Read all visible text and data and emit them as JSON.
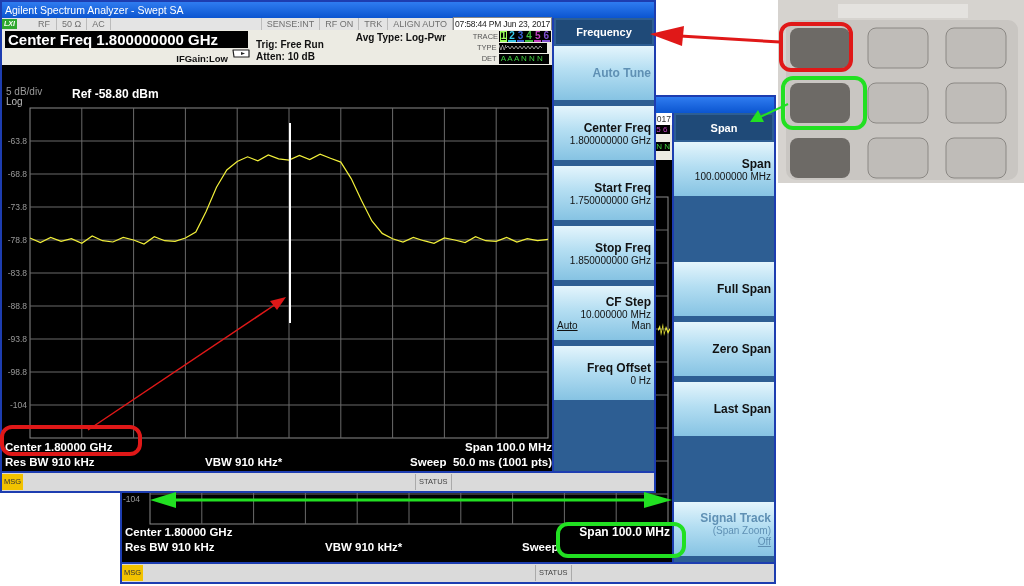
{
  "main_window": {
    "title": "Agilent Spectrum Analyzer - Swept SA",
    "lxi_badge": "LXI",
    "status_cells": [
      "RF",
      "50 Ω",
      "AC",
      "SENSE:INT",
      "RF ON",
      "TRK",
      "ALIGN AUTO"
    ],
    "timestamp": "07:58:44 PM Jun 23, 2017",
    "center_freq_banner": "Center Freq 1.800000000 GHz",
    "if_gain": "IFGain:Low",
    "trigger": "Trig: Free Run",
    "atten": "Atten: 10 dB",
    "avg_type": "Avg Type: Log-Pwr",
    "trace_panel": {
      "trace_label": "TRACE",
      "traces": [
        {
          "label": "1",
          "color": "#9cff5a",
          "selected": true
        },
        {
          "label": "2",
          "color": "#38c8e8",
          "selected": false
        },
        {
          "label": "3",
          "color": "#3a62d8",
          "selected": false
        },
        {
          "label": "4",
          "color": "#40c040",
          "selected": false
        },
        {
          "label": "5",
          "color": "#c040c0",
          "selected": false
        },
        {
          "label": "6",
          "color": "#8050d0",
          "selected": false
        }
      ],
      "type_label": "TYPE",
      "type_value": "W",
      "det_label": "DET",
      "det_value": "A A A N N N"
    },
    "scale": "5 dB/div",
    "ref": "Ref -58.80 dBm",
    "log": "Log",
    "chart_data": {
      "type": "line",
      "grid": true,
      "ylim": [
        -108.8,
        -58.8
      ],
      "yticks": [
        {
          "value": -63.8,
          "label": "-63.8"
        },
        {
          "value": -68.8,
          "label": "-68.8"
        },
        {
          "value": -73.8,
          "label": "-73.8"
        },
        {
          "value": -78.8,
          "label": "-78.8"
        },
        {
          "value": -83.8,
          "label": "-83.8"
        },
        {
          "value": -88.8,
          "label": "-88.8"
        },
        {
          "value": -93.8,
          "label": "-93.8"
        },
        {
          "value": -98.8,
          "label": "-98.8"
        },
        {
          "value": -103.8,
          "label": "-104"
        }
      ],
      "categories": [
        null,
        null,
        null,
        null,
        null,
        null,
        null,
        null,
        null,
        null,
        null,
        null,
        null,
        null,
        null,
        null,
        null,
        null,
        null,
        null,
        null,
        null,
        null,
        null,
        null,
        null,
        null,
        null,
        null,
        null,
        null,
        null,
        null,
        null,
        null,
        null,
        null,
        null,
        null,
        null,
        null,
        null,
        null,
        null,
        null,
        null,
        null,
        null,
        null,
        null,
        null
      ],
      "series": [
        {
          "color": "#f2f03a",
          "values": [
            -78.5,
            -79.2,
            -78.4,
            -79.0,
            -78.6,
            -79.3,
            -78.2,
            -78.9,
            -79.1,
            -78.4,
            -78.8,
            -79.4,
            -78.3,
            -78.9,
            -79.0,
            -78.5,
            -77.6,
            -74.5,
            -70.8,
            -68.2,
            -66.9,
            -66.2,
            -66.8,
            -65.9,
            -66.5,
            -66.7,
            -66.0,
            -66.6,
            -65.8,
            -66.4,
            -67.0,
            -69.5,
            -72.8,
            -75.9,
            -77.8,
            -78.6,
            -79.1,
            -78.4,
            -78.9,
            -79.3,
            -78.5,
            -78.8,
            -79.2,
            -78.3,
            -78.9,
            -79.0,
            -78.4,
            -79.1,
            -78.6,
            -78.9,
            -78.7
          ]
        }
      ]
    },
    "center": "Center 1.80000 GHz",
    "res_bw": "Res BW 910 kHz",
    "vbw": "VBW 910 kHz*",
    "span": "Span 100.0 MHz",
    "sweep": "Sweep  50.0 ms (1001 pts)",
    "msg": "MSG",
    "status": "STATUS",
    "softkey_menu": {
      "title": "Frequency",
      "keys": [
        {
          "kind": "plain",
          "label": "Auto Tune",
          "disabled": true
        },
        {
          "kind": "value",
          "label": "Center Freq",
          "value": "1.800000000 GHz",
          "disabled": false
        },
        {
          "kind": "value",
          "label": "Start Freq",
          "value": "1.750000000 GHz",
          "disabled": false
        },
        {
          "kind": "value",
          "label": "Stop Freq",
          "value": "1.850000000 GHz",
          "disabled": false
        },
        {
          "kind": "toggle",
          "label": "CF Step",
          "value": "10.000000 MHz",
          "disabled": false,
          "options": [
            {
              "label": "Auto",
              "selected": true
            },
            {
              "label": "Man",
              "selected": false
            }
          ]
        },
        {
          "kind": "value",
          "label": "Freq Offset",
          "value": "0 Hz",
          "disabled": false
        }
      ]
    }
  },
  "second_window": {
    "clock_fragment": "017",
    "trace_fragment": "5 6",
    "det_fragment": "N N",
    "y_label": "-104",
    "center": "Center 1.80000 GHz",
    "res_bw": "Res BW 910 kHz",
    "vbw": "VBW 910 kHz*",
    "sweep_label": "Sweep",
    "span": "Span 100.0 MHz",
    "msg": "MSG",
    "status": "STATUS",
    "softkey_menu": {
      "title": "Span",
      "keys": [
        {
          "kind": "value",
          "label": "Span",
          "value": "100.000000 MHz",
          "disabled": false
        },
        {
          "kind": "gap"
        },
        {
          "kind": "plain",
          "label": "Full Span",
          "disabled": false
        },
        {
          "kind": "plain",
          "label": "Zero Span",
          "disabled": false
        },
        {
          "kind": "plain",
          "label": "Last Span",
          "disabled": false
        },
        {
          "kind": "gap"
        },
        {
          "kind": "note",
          "label": "Signal Track",
          "note": "(Span Zoom)",
          "disabled": true,
          "options": [
            {
              "label": "Off",
              "selected": true
            }
          ]
        }
      ]
    }
  }
}
